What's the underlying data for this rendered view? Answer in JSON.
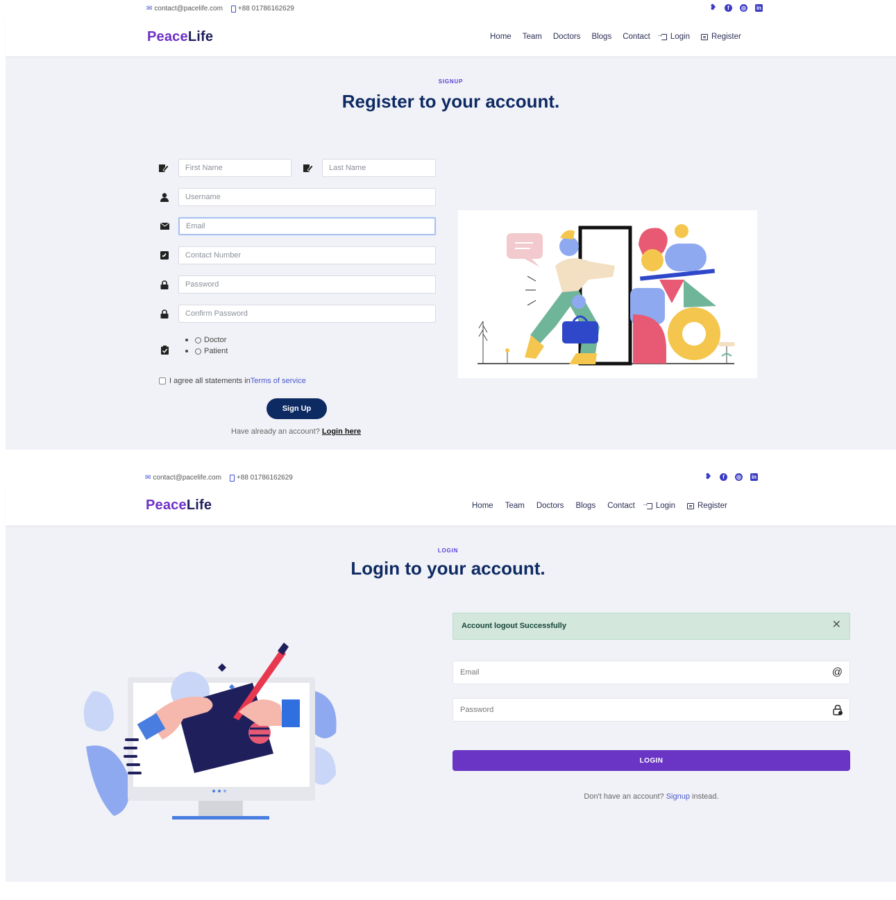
{
  "topbar": {
    "email": "contact@pacelife.com",
    "phone": "+88 01786162629",
    "social_icons": [
      "twitter-icon",
      "facebook-icon",
      "instagram-icon",
      "linkedin-icon"
    ]
  },
  "brand": {
    "part1": "Peace",
    "part2": "Life"
  },
  "nav": {
    "home": "Home",
    "team": "Team",
    "doctors": "Doctors",
    "blogs": "Blogs",
    "contact": "Contact",
    "login": "Login",
    "register": "Register"
  },
  "register": {
    "label": "SIGNUP",
    "title": "Register to your account.",
    "first_name_placeholder": "First Name",
    "last_name_placeholder": "Last Name",
    "username_placeholder": "Username",
    "email_placeholder": "Email",
    "contact_placeholder": "Contact Number",
    "password_placeholder": "Password",
    "confirm_password_placeholder": "Confirm Password",
    "role_options": [
      "Doctor",
      "Patient"
    ],
    "agree_text": "I agree all statements in ",
    "terms_link": "Terms of service",
    "signup_button": "Sign Up",
    "have_account_text": "Have already an account? ",
    "login_here": "Login here"
  },
  "login": {
    "label": "LOGIN",
    "title": "Login to your account.",
    "alert": "Account logout Successfully",
    "email_placeholder": "Email",
    "password_placeholder": "Password",
    "email_suffix": "@",
    "login_button": "LOGIN",
    "no_account_text": "Don't have an account? ",
    "signup_link": "Signup",
    "instead_text": " instead."
  },
  "colors": {
    "brand_purple": "#6d2fc6",
    "brand_navy": "#1f1f5c",
    "title_navy": "#0e2a63",
    "login_button": "#6a35c4",
    "alert_bg": "#d3e7dd",
    "page_bg": "#f1f2f7"
  }
}
